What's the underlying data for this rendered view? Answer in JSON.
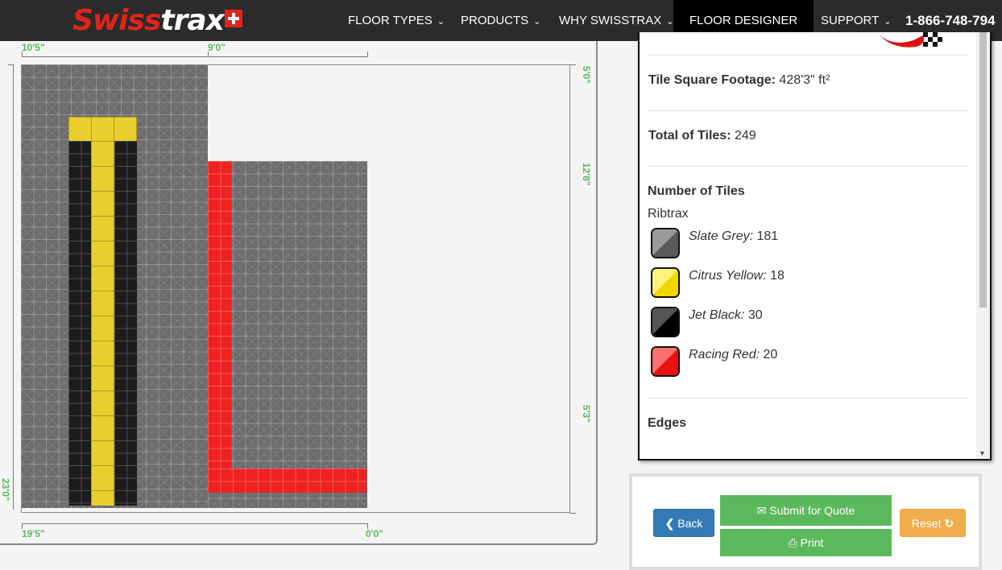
{
  "brand": {
    "name_part1": "Swiss",
    "name_part2": "trax"
  },
  "nav": {
    "items": [
      {
        "label": "FLOOR TYPES",
        "has_dropdown": true
      },
      {
        "label": "PRODUCTS",
        "has_dropdown": true
      },
      {
        "label": "WHY SWISSTRAX",
        "has_dropdown": true
      },
      {
        "label": "FLOOR DESIGNER",
        "has_dropdown": false,
        "active": true
      },
      {
        "label": "SUPPORT",
        "has_dropdown": true
      }
    ],
    "phone": "1-866-748-794"
  },
  "designer": {
    "dimensions": {
      "top_left": "10'5\"",
      "top_right": "9'0\"",
      "right_top": "5'0\"",
      "right_mid": "12'8\"",
      "right_bottom": "5'3\"",
      "left_total": "23'0\"",
      "bottom_left": "19'5\"",
      "bottom_right": "0'0\""
    },
    "colors": {
      "slate_grey": "#6c6c6c",
      "citrus_yellow": "#e9cf2e",
      "jet_black": "#1c1c1c",
      "racing_red": "#ee2222",
      "dimension_green": "#5cb85c"
    }
  },
  "summary": {
    "square_footage_label": "Tile Square Footage:",
    "square_footage_value": "428'3\" ft²",
    "total_tiles_label": "Total of Tiles:",
    "total_tiles_value": "249",
    "number_heading": "Number of Tiles",
    "tile_type": "Ribtrax",
    "tiles": [
      {
        "name": "Slate Grey:",
        "count": "181",
        "color_a": "#9a9a9a",
        "color_b": "#5a5a5a"
      },
      {
        "name": "Citrus Yellow:",
        "count": "18",
        "color_a": "#fff27a",
        "color_b": "#f2d600"
      },
      {
        "name": "Jet Black:",
        "count": "30",
        "color_a": "#555555",
        "color_b": "#000000"
      },
      {
        "name": "Racing Red:",
        "count": "20",
        "color_a": "#ff7070",
        "color_b": "#e81010"
      }
    ],
    "edges_heading": "Edges"
  },
  "actions": {
    "back": "Back",
    "submit_quote": "Submit for Quote",
    "print": "Print",
    "reset": "Reset"
  }
}
